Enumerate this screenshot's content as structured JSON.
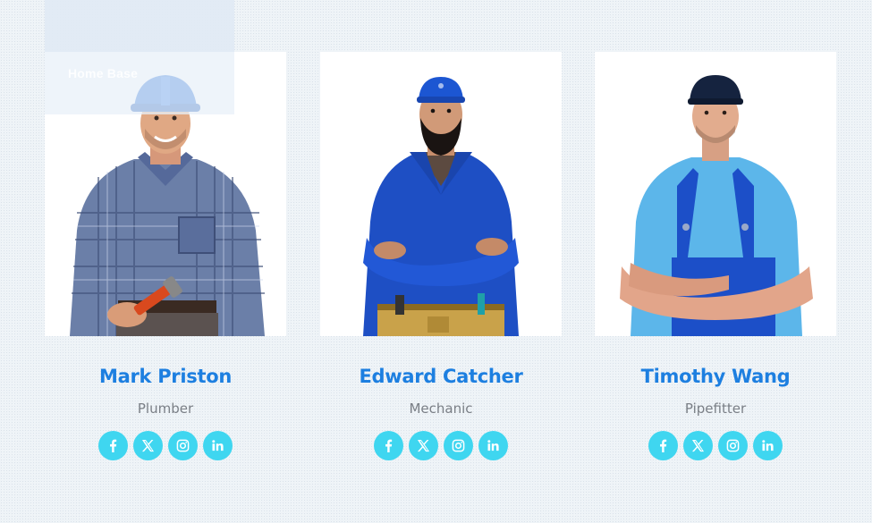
{
  "breadcrumb": {
    "home_label": "Home Base"
  },
  "team": [
    {
      "name": "Mark Priston",
      "role": "Plumber",
      "photo_icon": "worker-hardhat-plaid-shirt"
    },
    {
      "name": "Edward Catcher",
      "role": "Mechanic",
      "photo_icon": "worker-blue-coverall-toolbelt"
    },
    {
      "name": "Timothy Wang",
      "role": "Pipefitter",
      "photo_icon": "worker-overalls-cap"
    }
  ],
  "social": [
    "facebook-icon",
    "x-twitter-icon",
    "instagram-icon",
    "linkedin-icon"
  ],
  "colors": {
    "name": "#1d7fe0",
    "role": "#7a7f86",
    "social_bg": "#3fd6f0",
    "background": "#eef3f7"
  }
}
